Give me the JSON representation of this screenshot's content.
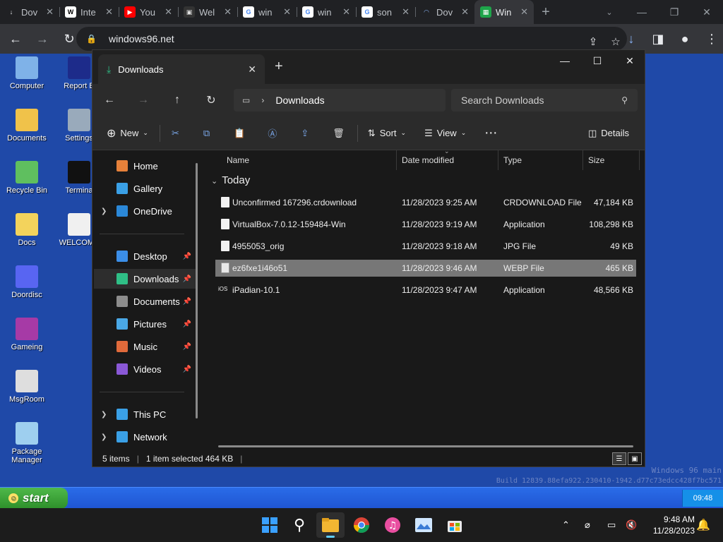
{
  "browser": {
    "tabs": [
      {
        "title": "Dov",
        "favicon": "download-icon"
      },
      {
        "title": "Inte",
        "favicon": "wikipedia-icon"
      },
      {
        "title": "You",
        "favicon": "youtube-icon"
      },
      {
        "title": "Wel",
        "favicon": "site-icon"
      },
      {
        "title": "win",
        "favicon": "google-icon"
      },
      {
        "title": "win",
        "favicon": "google-icon"
      },
      {
        "title": "son",
        "favicon": "google-icon"
      },
      {
        "title": "Dov",
        "favicon": "loading-icon"
      },
      {
        "title": "Win",
        "favicon": "windows96-icon",
        "active": true
      }
    ],
    "url": "windows96.net"
  },
  "desktop": {
    "icons_left": [
      {
        "label": "Computer",
        "color": "#7fb2e8"
      },
      {
        "label": "Documents",
        "color": "#f0c24a"
      },
      {
        "label": "Recycle Bin",
        "color": "#5fbf5f"
      },
      {
        "label": "Docs",
        "color": "#f3d35c"
      },
      {
        "label": "Doordisc",
        "color": "#5865f2"
      },
      {
        "label": "Gameing",
        "color": "#a63aa6"
      },
      {
        "label": "MsgRoom",
        "color": "#dedede"
      },
      {
        "label": "Package\nManager",
        "color": "#9ecfef"
      }
    ],
    "icons_right": [
      {
        "label": "Report B",
        "color": "#1d2b8a"
      },
      {
        "label": "Settings",
        "color": "#9ab"
      },
      {
        "label": "Termina",
        "color": "#111"
      },
      {
        "label": "WELCOME",
        "color": "#f0f0f0"
      }
    ],
    "watermark_line1": "Windows 96 main",
    "watermark_line2": "Build 12839.88efa922.230410-1942.d77c73edcc428f7bc571"
  },
  "win96_taskbar": {
    "start_label": "start",
    "tray_time": "09:48"
  },
  "explorer": {
    "tab_title": "Downloads",
    "address_segment": "Downloads",
    "search_placeholder": "Search Downloads",
    "commands": {
      "new": "New",
      "sort": "Sort",
      "view": "View",
      "details": "Details"
    },
    "nav": [
      {
        "label": "Home",
        "color": "#e6813a"
      },
      {
        "label": "Gallery",
        "color": "#3aa0e6"
      },
      {
        "label": "OneDrive",
        "color": "#2b88d8",
        "expandable": true
      },
      {
        "label": "Desktop",
        "color": "#3b8ee8",
        "pinned": true
      },
      {
        "label": "Downloads",
        "color": "#2fbf86",
        "pinned": true,
        "selected": true
      },
      {
        "label": "Documents",
        "color": "#8d8d8d",
        "pinned": true
      },
      {
        "label": "Pictures",
        "color": "#4aa8e6",
        "pinned": true
      },
      {
        "label": "Music",
        "color": "#e06a3b",
        "pinned": true
      },
      {
        "label": "Videos",
        "color": "#8a58d6",
        "pinned": true
      },
      {
        "label": "This PC",
        "color": "#3aa0e6",
        "expandable": true
      },
      {
        "label": "Network",
        "color": "#3aa0e6",
        "expandable": true
      }
    ],
    "columns": {
      "name": "Name",
      "date": "Date modified",
      "type": "Type",
      "size": "Size"
    },
    "group_label": "Today",
    "files": [
      {
        "name": "Unconfirmed 167296.crdownload",
        "date": "11/28/2023 9:25 AM",
        "type": "CRDOWNLOAD File",
        "size": "47,184 KB"
      },
      {
        "name": "VirtualBox-7.0.12-159484-Win",
        "date": "11/28/2023 9:19 AM",
        "type": "Application",
        "size": "108,298 KB"
      },
      {
        "name": "4955053_orig",
        "date": "11/28/2023 9:18 AM",
        "type": "JPG File",
        "size": "49 KB"
      },
      {
        "name": "ez6fxe1i46o51",
        "date": "11/28/2023 9:46 AM",
        "type": "WEBP File",
        "size": "465 KB",
        "selected": true
      },
      {
        "name": "iPadian-10.1",
        "date": "11/28/2023 9:47 AM",
        "type": "Application",
        "size": "48,566 KB",
        "badge": "iOS"
      }
    ],
    "status": {
      "count": "5 items",
      "selection": "1 item selected  464 KB"
    }
  },
  "win11_taskbar": {
    "time": "9:48 AM",
    "date": "11/28/2023"
  }
}
